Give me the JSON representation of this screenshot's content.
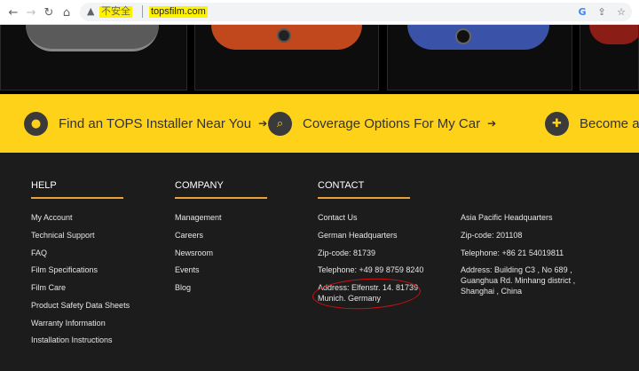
{
  "browser": {
    "insecure_label": "不安全",
    "url": "topsfilm.com"
  },
  "banner": {
    "items": [
      {
        "label": "Find an TOPS Installer Near You",
        "icon": "location-pin-icon"
      },
      {
        "label": "Coverage Options For My Car",
        "icon": "search-icon"
      },
      {
        "label": "Become a",
        "icon": "add-user-icon"
      }
    ],
    "colors": {
      "background": "#ffd21a",
      "icon_bg": "#3a3a3a"
    }
  },
  "footer": {
    "help": {
      "title": "HELP",
      "links": [
        "My Account",
        "Technical Support",
        "FAQ",
        "Film Specifications",
        "Film Care",
        "Product Safety Data Sheets",
        "Warranty Information",
        "Installation Instructions"
      ]
    },
    "company": {
      "title": "COMPANY",
      "links": [
        "Management",
        "Careers",
        "Newsroom",
        "Events",
        "Blog"
      ]
    },
    "contact": {
      "title": "CONTACT",
      "lines": [
        "Contact Us",
        "German Headquarters",
        "Zip-code: 81739",
        "Telephone: +49 89 8759 8240"
      ],
      "address_line1": "Address: Elfenstr. 14. 81739",
      "address_line2": "Munich. Germany"
    },
    "asia": {
      "title": "Asia Pacific Headquarters",
      "zip": "Zip-code: 201108",
      "phone": "Telephone: +86 21 54019811",
      "address_line1": "Address: Building C3 , No 689 ,",
      "address_line2": "Guanghua Rd. Minhang district ,",
      "address_line3": "Shanghai , China"
    },
    "accent_color": "#e8a23b"
  }
}
